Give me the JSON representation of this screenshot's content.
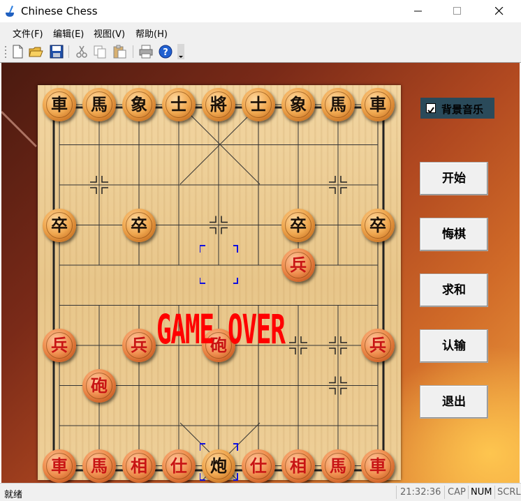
{
  "window": {
    "title": "Chinese Chess"
  },
  "menu": {
    "file": "文件(F)",
    "edit": "编辑(E)",
    "view": "视图(V)",
    "help": "帮助(H)"
  },
  "toolbar": {
    "icons": [
      "new-icon",
      "open-icon",
      "save-icon",
      "cut-icon",
      "copy-icon",
      "paste-icon",
      "print-icon",
      "help-icon"
    ]
  },
  "board": {
    "overlay_text": "GAME OVER",
    "pieces": [
      {
        "c": "車",
        "s": "black",
        "f": 0,
        "r": 0
      },
      {
        "c": "馬",
        "s": "black",
        "f": 1,
        "r": 0
      },
      {
        "c": "象",
        "s": "black",
        "f": 2,
        "r": 0
      },
      {
        "c": "士",
        "s": "black",
        "f": 3,
        "r": 0
      },
      {
        "c": "將",
        "s": "black",
        "f": 4,
        "r": 0
      },
      {
        "c": "士",
        "s": "black",
        "f": 5,
        "r": 0
      },
      {
        "c": "象",
        "s": "black",
        "f": 6,
        "r": 0
      },
      {
        "c": "馬",
        "s": "black",
        "f": 7,
        "r": 0
      },
      {
        "c": "車",
        "s": "black",
        "f": 8,
        "r": 0
      },
      {
        "c": "卒",
        "s": "black",
        "f": 0,
        "r": 3
      },
      {
        "c": "卒",
        "s": "black",
        "f": 2,
        "r": 3
      },
      {
        "c": "卒",
        "s": "black",
        "f": 6,
        "r": 3
      },
      {
        "c": "卒",
        "s": "black",
        "f": 8,
        "r": 3
      },
      {
        "c": "兵",
        "s": "red",
        "f": 6,
        "r": 4
      },
      {
        "c": "兵",
        "s": "red",
        "f": 0,
        "r": 6
      },
      {
        "c": "兵",
        "s": "red",
        "f": 2,
        "r": 6
      },
      {
        "c": "砲",
        "s": "red",
        "f": 4,
        "r": 6
      },
      {
        "c": "兵",
        "s": "red",
        "f": 8,
        "r": 6
      },
      {
        "c": "砲",
        "s": "red",
        "f": 1,
        "r": 7
      },
      {
        "c": "車",
        "s": "red",
        "f": 0,
        "r": 9
      },
      {
        "c": "馬",
        "s": "red",
        "f": 1,
        "r": 9
      },
      {
        "c": "相",
        "s": "red",
        "f": 2,
        "r": 9
      },
      {
        "c": "仕",
        "s": "red",
        "f": 3,
        "r": 9
      },
      {
        "c": "炮",
        "s": "black",
        "f": 4,
        "r": 9
      },
      {
        "c": "仕",
        "s": "red",
        "f": 5,
        "r": 9
      },
      {
        "c": "相",
        "s": "red",
        "f": 6,
        "r": 9
      },
      {
        "c": "馬",
        "s": "red",
        "f": 7,
        "r": 9
      },
      {
        "c": "車",
        "s": "red",
        "f": 8,
        "r": 9
      }
    ]
  },
  "side": {
    "music_label": "背景音乐",
    "music_checked": true,
    "buttons": {
      "start": "开始",
      "undo": "悔棋",
      "draw": "求和",
      "resign": "认输",
      "exit": "退出"
    }
  },
  "status": {
    "ready": "就绪",
    "time": "21:32:36",
    "cap": "CAP",
    "num": "NUM",
    "scrl": "SCRL"
  }
}
